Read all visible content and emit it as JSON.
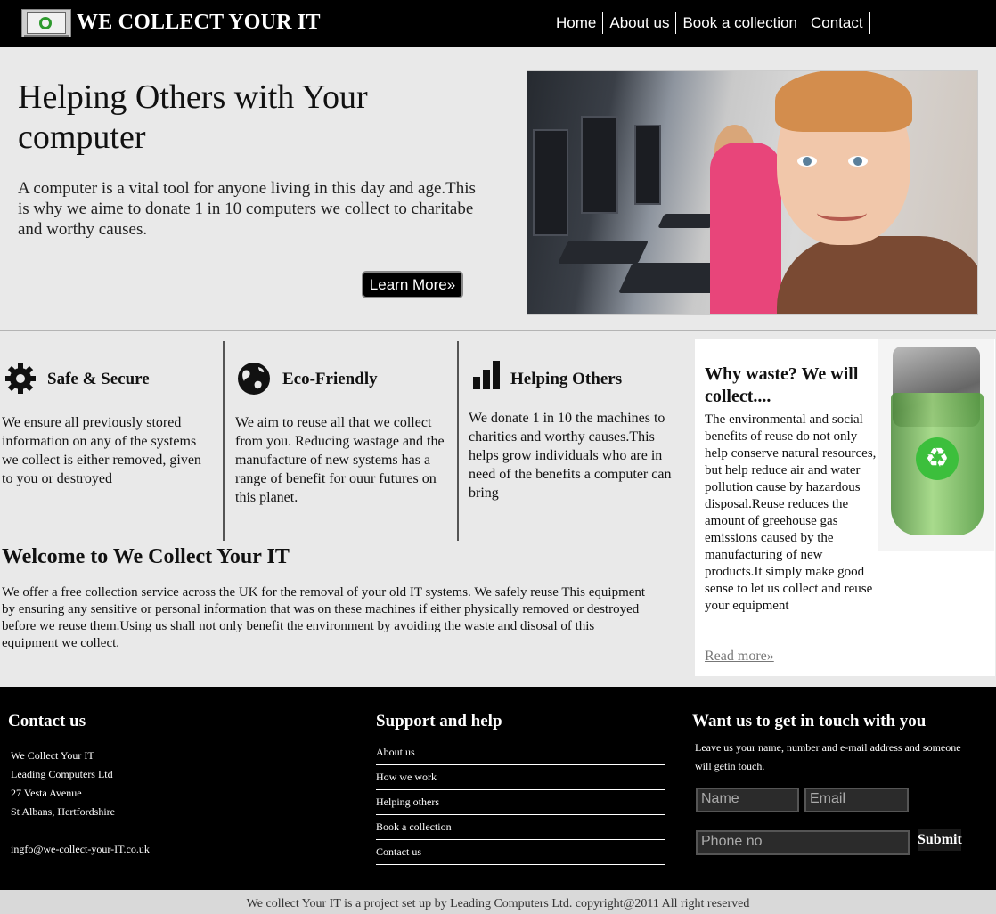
{
  "header": {
    "brand": "WE COLLECT YOUR IT",
    "nav": [
      "Home",
      "About us",
      "Book a collection",
      "Contact"
    ]
  },
  "hero": {
    "title": "Helping Others with Your computer",
    "text": "A computer is a vital tool for anyone living in this day and age.This is why we aime to donate 1 in 10 computers we collect to charitabe and worthy causes.",
    "button": "Learn More»"
  },
  "features": [
    {
      "title": "Safe & Secure",
      "icon": "gear-icon",
      "text": "We ensure all previously stored information on any of the systems we collect is either removed, given to you or destroyed"
    },
    {
      "title": "Eco-Friendly",
      "icon": "globe-icon",
      "text": "We aim to reuse all that we collect from you. Reducing wastage and the manufacture of new systems has a range of benefit for ouur futures on this planet."
    },
    {
      "title": "Helping Others",
      "icon": "bar-chart-icon",
      "text": "We donate 1 in 10 the machines to charities and worthy causes.This helps grow individuals who are in need of the benefits a computer can bring"
    }
  ],
  "welcome": {
    "title": "Welcome to We Collect Your IT",
    "text": "We offer a free collection service across the UK for the removal of your old IT systems. We safely reuse This equipment by ensuring any sensitive or personal information that was on these machines if either physically removed or destroyed before we reuse them.Using us shall not only benefit the environment by avoiding the waste and disosal of this equipment we collect."
  },
  "aside": {
    "title": "Why waste? We will collect....",
    "text": "The environmental and social benefits of reuse do not only help conserve natural resources, but help reduce air and water pollution cause by hazardous disposal.Reuse reduces the amount of greehouse gas emissions caused by the manufacturing of new products.It simply make good sense to let us collect and reuse your equipment",
    "link": "Read more»"
  },
  "footer": {
    "contact": {
      "title": "Contact us",
      "lines": [
        "We Collect Your IT",
        "Leading Computers Ltd",
        "27 Vesta Avenue",
        "St Albans, Hertfordshire",
        "",
        "ingfo@we-collect-your-IT.co.uk"
      ]
    },
    "support": {
      "title": "Support and help",
      "links": [
        "About us",
        "How we work",
        "Helping others",
        "Book a collection",
        "Contact us"
      ]
    },
    "touch": {
      "title": "Want us to get in touch with you",
      "text": "Leave us your name, number and e-mail address and someone will getin touch.",
      "name_placeholder": "Name",
      "email_placeholder": "Email",
      "phone_placeholder": "Phone no",
      "submit": "Submit"
    }
  },
  "copyright": "We collect Your IT is a project set up by Leading Computers Ltd. copyright@2011 All right reserved",
  "colors": {
    "header_bg": "#000000",
    "body_bg": "#e9e9e9",
    "footer_bg": "#000000",
    "accent_green": "#3cbf3c"
  }
}
